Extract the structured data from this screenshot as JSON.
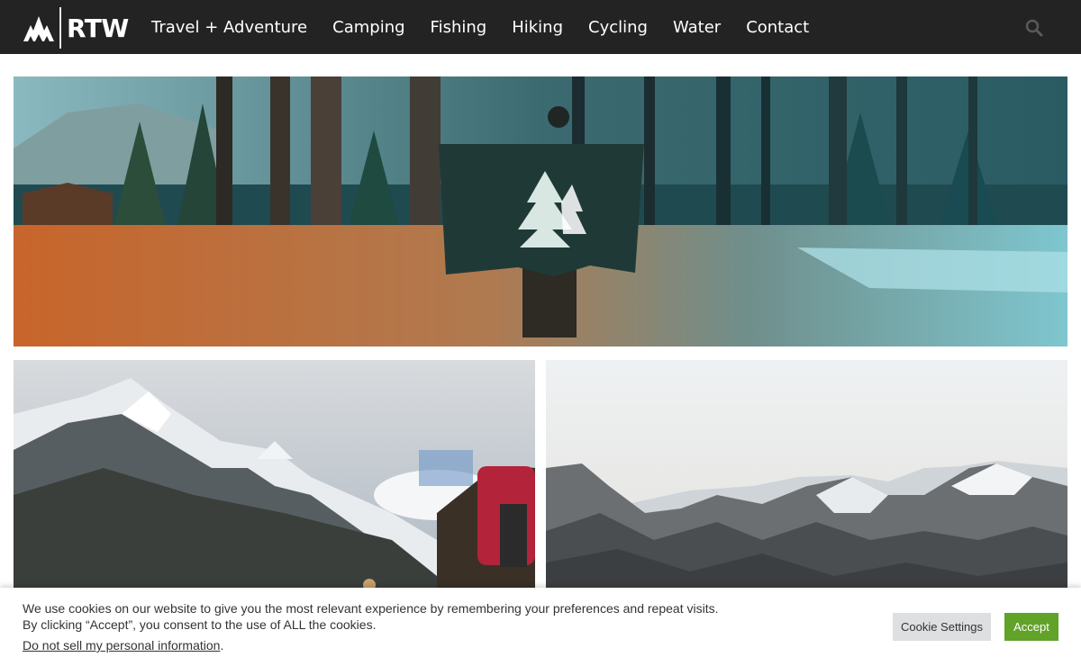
{
  "header": {
    "logo_text": "RTW",
    "nav": [
      "Travel + Adventure",
      "Camping",
      "Fishing",
      "Hiking",
      "Cycling",
      "Water",
      "Contact"
    ],
    "search_icon": "search-icon",
    "background": "#232323"
  },
  "cookie_banner": {
    "message": "We use cookies on our website to give you the most relevant experience by remembering your preferences and repeat visits. By clicking “Accept”, you consent to the use of ALL the cookies.",
    "do_not_sell_link": "Do not sell my personal information",
    "do_not_sell_suffix": ".",
    "settings_label": "Cookie Settings",
    "accept_label": "Accept",
    "accept_color": "#61a229"
  }
}
